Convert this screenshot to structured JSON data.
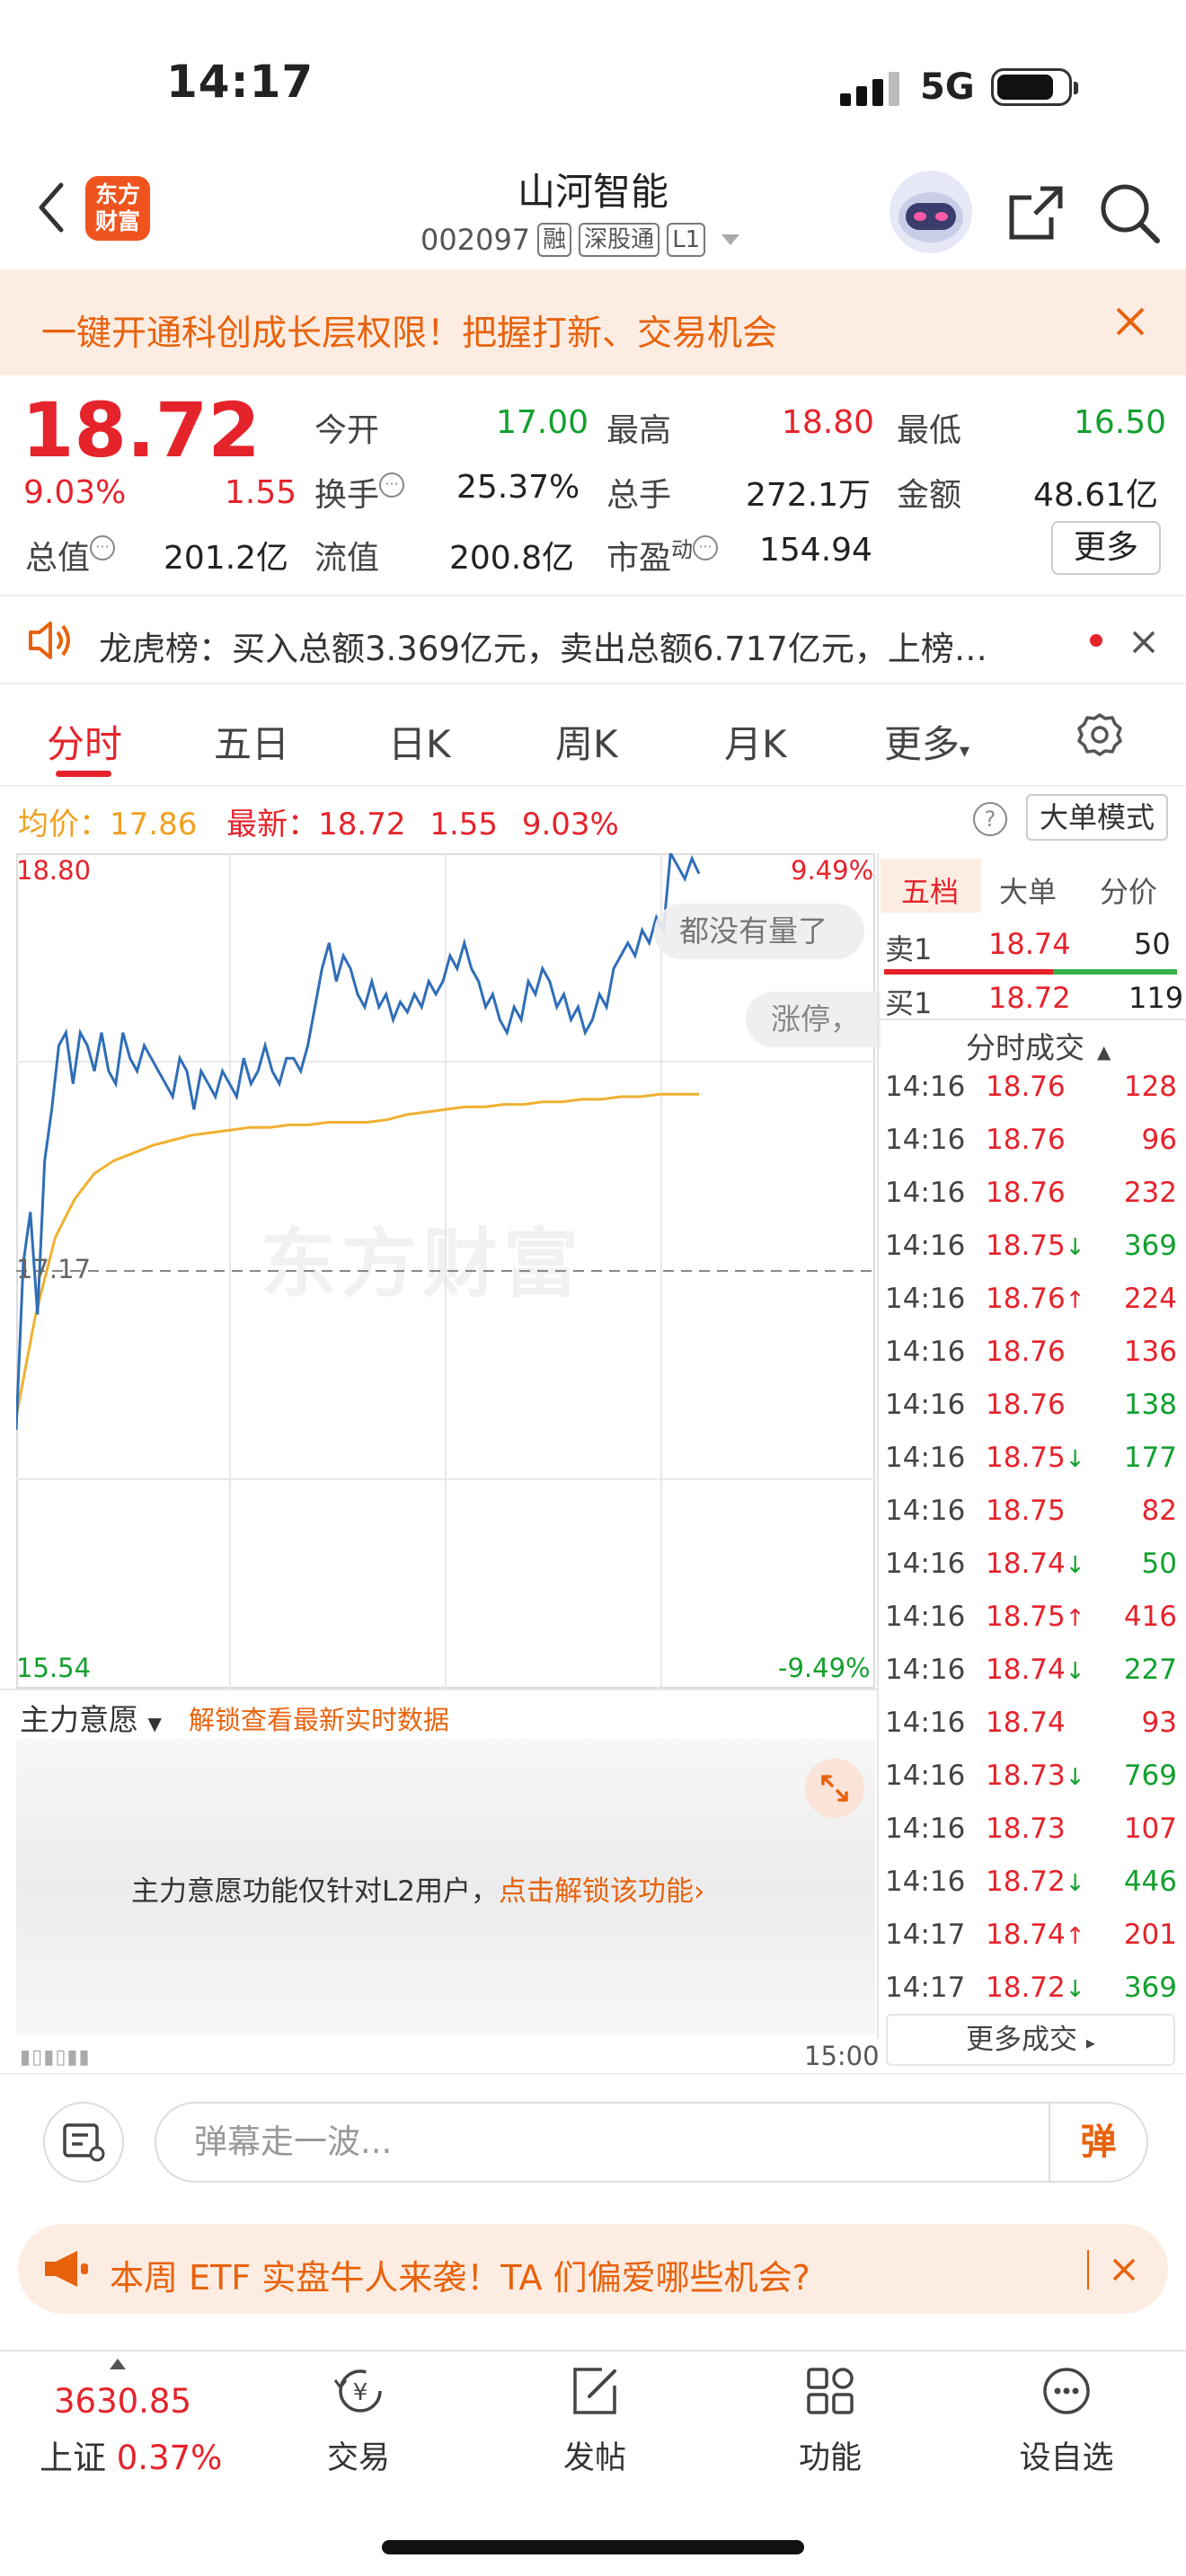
{
  "status_bar": {
    "time": "14:17",
    "network": "5G"
  },
  "header": {
    "logo_text_1": "东方",
    "logo_text_2": "财富",
    "stock_name": "山河智能",
    "stock_code": "002097",
    "tags": [
      "融",
      "深股通",
      "L1"
    ]
  },
  "banner": {
    "text": "一键开通科创成长层权限！把握打新、交易机会"
  },
  "quote": {
    "price": "18.72",
    "change_pct": "9.03%",
    "change": "1.55",
    "rows": [
      [
        {
          "label": "今开",
          "value": "17.00",
          "color": "green"
        },
        {
          "label": "最高",
          "value": "18.80",
          "color": "red"
        },
        {
          "label": "最低",
          "value": "16.50",
          "color": "green"
        }
      ],
      [
        {
          "label": "换手",
          "value": "25.37%",
          "color": "black"
        },
        {
          "label": "总手",
          "value": "272.1万",
          "color": "black"
        },
        {
          "label": "金额",
          "value": "48.61亿",
          "color": "black"
        }
      ]
    ],
    "total_mv_label": "总值",
    "total_mv": "201.2亿",
    "float_mv_label": "流值",
    "float_mv": "200.8亿",
    "pe_label": "市盈",
    "pe_sup": "动",
    "pe": "154.94",
    "more_label": "更多"
  },
  "notice": {
    "text": "龙虎榜：买入总额3.369亿元，卖出总额6.717亿元，上榜…"
  },
  "tabs": [
    "分时",
    "五日",
    "日K",
    "周K",
    "月K",
    "更多"
  ],
  "chart_header": {
    "avg_label": "均价：",
    "avg_value": "17.86",
    "latest_label": "最新：",
    "latest_value": "18.72",
    "change": "1.55",
    "change_pct": "9.03%",
    "bigmode_label": "大单模式"
  },
  "chart_labels": {
    "top_price": "18.80",
    "top_pct": "9.49%",
    "mid_price": "17.17",
    "bottom_price": "15.54",
    "bottom_pct": "-9.49%",
    "watermark": "东方财富",
    "float1": "都没有量了",
    "float2": "涨停，"
  },
  "chart_data": {
    "type": "line",
    "title": "",
    "ylim": [
      15.54,
      18.8
    ],
    "prev_close": 17.17,
    "x_range": [
      "09:30",
      "15:00"
    ],
    "series": [
      {
        "name": "最新",
        "color": "#2f6db8",
        "values": [
          16.55,
          17.2,
          17.4,
          17.0,
          17.6,
          17.8,
          18.05,
          18.1,
          17.9,
          18.1,
          18.05,
          17.95,
          18.1,
          17.95,
          17.9,
          18.1,
          18.0,
          17.95,
          18.05,
          18.0,
          17.95,
          17.9,
          17.85,
          18.0,
          17.95,
          17.8,
          17.95,
          17.9,
          17.85,
          17.95,
          17.9,
          17.85,
          18.0,
          17.9,
          17.95,
          18.05,
          17.95,
          17.9,
          18.0,
          18.0,
          17.95,
          18.05,
          18.2,
          18.35,
          18.45,
          18.3,
          18.4,
          18.35,
          18.25,
          18.2,
          18.3,
          18.2,
          18.25,
          18.15,
          18.22,
          18.18,
          18.25,
          18.2,
          18.3,
          18.25,
          18.3,
          18.4,
          18.35,
          18.45,
          18.35,
          18.3,
          18.2,
          18.25,
          18.15,
          18.1,
          18.2,
          18.15,
          18.3,
          18.25,
          18.35,
          18.3,
          18.2,
          18.25,
          18.15,
          18.2,
          18.1,
          18.15,
          18.25,
          18.2,
          18.35,
          18.4,
          18.45,
          18.4,
          18.5,
          18.45,
          18.55,
          18.5,
          18.8,
          18.75,
          18.7,
          18.78,
          18.72
        ]
      },
      {
        "name": "均价",
        "color": "#f0b030",
        "values": [
          16.6,
          17.0,
          17.3,
          17.45,
          17.55,
          17.6,
          17.63,
          17.66,
          17.68,
          17.7,
          17.71,
          17.72,
          17.73,
          17.73,
          17.74,
          17.74,
          17.75,
          17.75,
          17.75,
          17.76,
          17.78,
          17.79,
          17.8,
          17.81,
          17.81,
          17.82,
          17.82,
          17.83,
          17.83,
          17.84,
          17.84,
          17.85,
          17.85,
          17.86,
          17.86,
          17.86
        ]
      }
    ]
  },
  "order_book": {
    "tabs": [
      "五档",
      "大单",
      "分价"
    ],
    "sell1": {
      "label": "卖1",
      "price": "18.74",
      "volume": "50"
    },
    "buy1": {
      "label": "买1",
      "price": "18.72",
      "volume": "119"
    },
    "trades_header": "分时成交",
    "trades": [
      {
        "time": "14:16",
        "price": "18.76",
        "arrow": "",
        "volume": "128",
        "color": "red"
      },
      {
        "time": "14:16",
        "price": "18.76",
        "arrow": "",
        "volume": "96",
        "color": "red"
      },
      {
        "time": "14:16",
        "price": "18.76",
        "arrow": "",
        "volume": "232",
        "color": "red"
      },
      {
        "time": "14:16",
        "price": "18.75",
        "arrow": "↓",
        "volume": "369",
        "color": "green"
      },
      {
        "time": "14:16",
        "price": "18.76",
        "arrow": "↑",
        "volume": "224",
        "color": "red"
      },
      {
        "time": "14:16",
        "price": "18.76",
        "arrow": "",
        "volume": "136",
        "color": "red"
      },
      {
        "time": "14:16",
        "price": "18.76",
        "arrow": "",
        "volume": "138",
        "color": "green"
      },
      {
        "time": "14:16",
        "price": "18.75",
        "arrow": "↓",
        "volume": "177",
        "color": "green"
      },
      {
        "time": "14:16",
        "price": "18.75",
        "arrow": "",
        "volume": "82",
        "color": "red"
      },
      {
        "time": "14:16",
        "price": "18.74",
        "arrow": "↓",
        "volume": "50",
        "color": "green"
      },
      {
        "time": "14:16",
        "price": "18.75",
        "arrow": "↑",
        "volume": "416",
        "color": "red"
      },
      {
        "time": "14:16",
        "price": "18.74",
        "arrow": "↓",
        "volume": "227",
        "color": "green"
      },
      {
        "time": "14:16",
        "price": "18.74",
        "arrow": "",
        "volume": "93",
        "color": "red"
      },
      {
        "time": "14:16",
        "price": "18.73",
        "arrow": "↓",
        "volume": "769",
        "color": "green"
      },
      {
        "time": "14:16",
        "price": "18.73",
        "arrow": "",
        "volume": "107",
        "color": "red"
      },
      {
        "time": "14:16",
        "price": "18.72",
        "arrow": "↓",
        "volume": "446",
        "color": "green"
      },
      {
        "time": "14:17",
        "price": "18.74",
        "arrow": "↑",
        "volume": "201",
        "color": "red"
      },
      {
        "time": "14:17",
        "price": "18.72",
        "arrow": "↓",
        "volume": "369",
        "color": "green"
      }
    ],
    "more_trades": "更多成交"
  },
  "main_force": {
    "label": "主力意愿",
    "unlock": "解锁查看最新实时数据",
    "message": "主力意愿功能仅针对L2用户，",
    "link": "点击解锁该功能",
    "end_time": "15:00"
  },
  "comment": {
    "placeholder": "弹幕走一波...",
    "button": "弹"
  },
  "promo": {
    "text": "本周 ETF 实盘牛人来袭！TA 们偏爱哪些机会?"
  },
  "bottom_nav": {
    "index_value": "3630.85",
    "index_name": "上证",
    "index_pct": "0.37%",
    "items": [
      "交易",
      "发帖",
      "功能",
      "设自选"
    ]
  }
}
